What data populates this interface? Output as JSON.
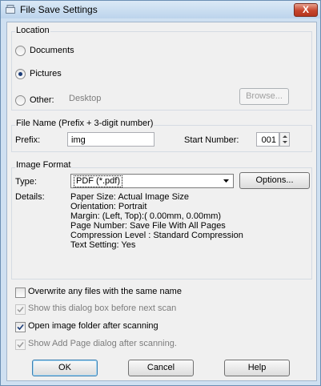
{
  "window": {
    "title": "File Save Settings",
    "close_label": "X"
  },
  "location": {
    "section_label": "Location",
    "options": [
      {
        "label": "Documents",
        "selected": false
      },
      {
        "label": "Pictures",
        "selected": true
      },
      {
        "label": "Other:",
        "selected": false
      }
    ],
    "other_path": "Desktop",
    "browse_label": "Browse..."
  },
  "file_name": {
    "section_label": "File Name (Prefix + 3-digit number)",
    "prefix_label": "Prefix:",
    "prefix_value": "img",
    "start_number_label": "Start Number:",
    "start_number_value": "001"
  },
  "image_format": {
    "section_label": "Image Format",
    "type_label": "Type:",
    "type_value": "PDF (*.pdf)",
    "options_label": "Options...",
    "details_label": "Details:",
    "details": [
      "Paper Size: Actual Image Size",
      "Orientation: Portrait",
      "Margin: (Left, Top):( 0.00mm, 0.00mm)",
      "Page Number: Save File With All Pages",
      "Compression Level : Standard Compression",
      "Text Setting: Yes"
    ]
  },
  "checkboxes": [
    {
      "label": "Overwrite any files with the same name",
      "checked": false,
      "enabled": true
    },
    {
      "label": "Show this dialog box before next scan",
      "checked": true,
      "enabled": false
    },
    {
      "label": "Open image folder after scanning",
      "checked": true,
      "enabled": true
    },
    {
      "label": "Show Add Page dialog after scanning.",
      "checked": true,
      "enabled": false
    }
  ],
  "buttons": {
    "ok": "OK",
    "cancel": "Cancel",
    "help": "Help"
  }
}
